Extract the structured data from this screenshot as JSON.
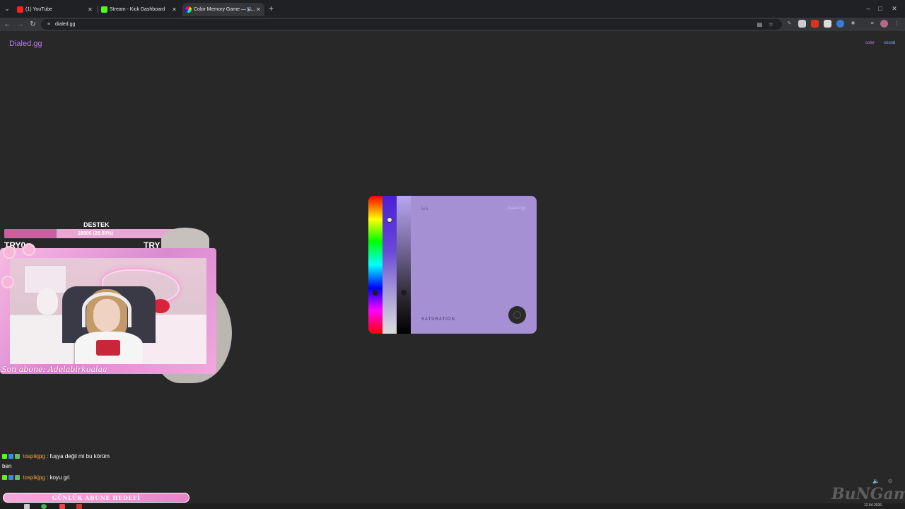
{
  "browser": {
    "tabs": [
      {
        "title": "(1) YouTube",
        "favicon_color": "#ff2020",
        "active": false
      },
      {
        "title": "Stream - Kick Dashboard",
        "favicon_color": "#53fc18",
        "active": false
      },
      {
        "title": "Color Memory Game — H...",
        "favicon_color": "#b87de8",
        "active": true
      }
    ],
    "url": "dialed.gg",
    "icons": {
      "tab_search": "chevron-down-icon",
      "new_tab": "plus-icon",
      "back": "arrow-left-icon",
      "forward": "arrow-right-icon",
      "reload": "reload-icon",
      "bookmark": "star-icon",
      "install": "install-icon",
      "extensions": "puzzle-icon",
      "menu": "kebab-icon"
    }
  },
  "page": {
    "logo": "Dialed.gg",
    "nav": {
      "color": "color",
      "sound": "sound"
    },
    "accent_color": "#b87de8",
    "sound_color": "#7ea4ff"
  },
  "game": {
    "counter": "5/5",
    "brand": "Dialed.gg",
    "mode_label": "SATURATION",
    "card_color": "#a690d4",
    "hue_level": 0.705,
    "saturation_level": 0.175,
    "brightness_level": 0.705
  },
  "stream_overlay": {
    "destek_label": "DESTEK",
    "progress_text": "2850€ (28.50%)",
    "progress_fraction": 0.285,
    "try_left": "TRY0",
    "try_right": "TRY",
    "last_sub": "Son abone: Adelabirkoalaa"
  },
  "chat": [
    {
      "user": "tospikjpg",
      "separator": " : ",
      "text": "fuşya değil mi bu körüm"
    },
    {
      "user": "",
      "separator": "",
      "text": "ben"
    },
    {
      "user": "tospikjpg",
      "separator": " : ",
      "text": "koyu gri"
    }
  ],
  "goal_bar": "GÜNLÜK ABUNE HEDEFİ",
  "taskbar": {
    "watermark": "BuNGame",
    "date": "12.04.2026"
  }
}
